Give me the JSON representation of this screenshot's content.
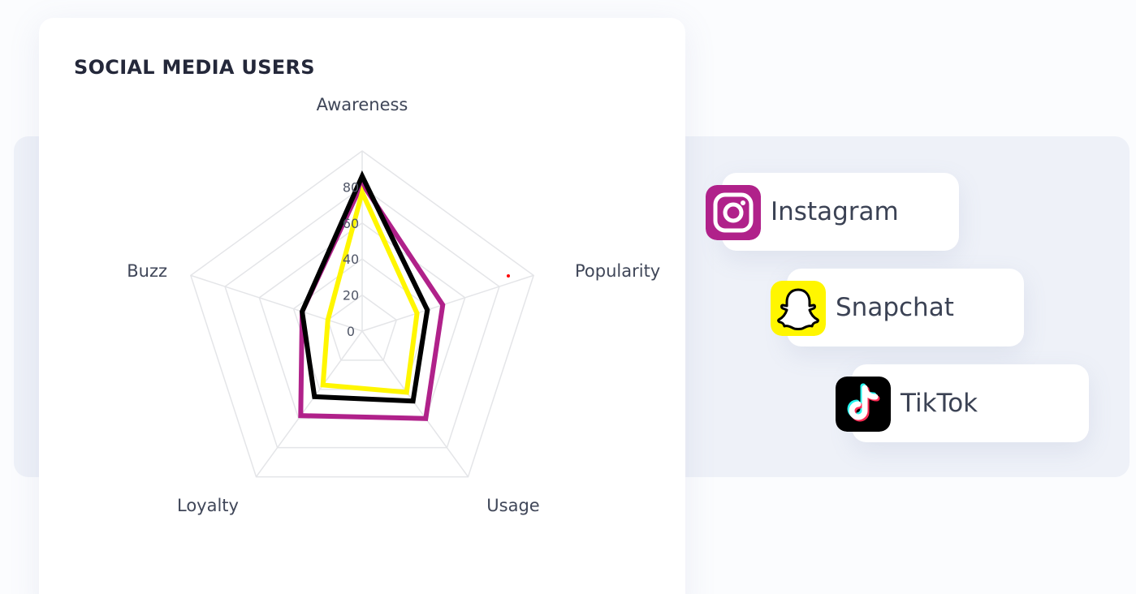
{
  "colors": {
    "instagram": "#b0218a",
    "snapchat": "#fff600",
    "tiktok": "#000000",
    "grid": "#e4e5e8",
    "card": "#ffffff",
    "backdrop": "#eef1f8"
  },
  "chart_data": {
    "type": "radar",
    "title": "SOCIAL MEDIA USERS",
    "axes": [
      "Awareness",
      "Popularity",
      "Usage",
      "Loyalty",
      "Buzz"
    ],
    "ticks": [
      0,
      20,
      40,
      60,
      80
    ],
    "rlim": [
      0,
      100
    ],
    "grid": true,
    "legend_position": "right",
    "series": [
      {
        "name": "Instagram",
        "color": "#b0218a",
        "values": [
          82,
          47,
          60,
          58,
          35
        ]
      },
      {
        "name": "TikTok",
        "color": "#000000",
        "values": [
          86,
          38,
          48,
          45,
          35
        ]
      },
      {
        "name": "Snapchat",
        "color": "#fff600",
        "values": [
          77,
          32,
          42,
          37,
          20
        ]
      }
    ]
  },
  "legend": {
    "items": [
      {
        "label": "Instagram",
        "icon": "instagram-icon"
      },
      {
        "label": "Snapchat",
        "icon": "snapchat-icon"
      },
      {
        "label": "TikTok",
        "icon": "tiktok-icon"
      }
    ]
  }
}
